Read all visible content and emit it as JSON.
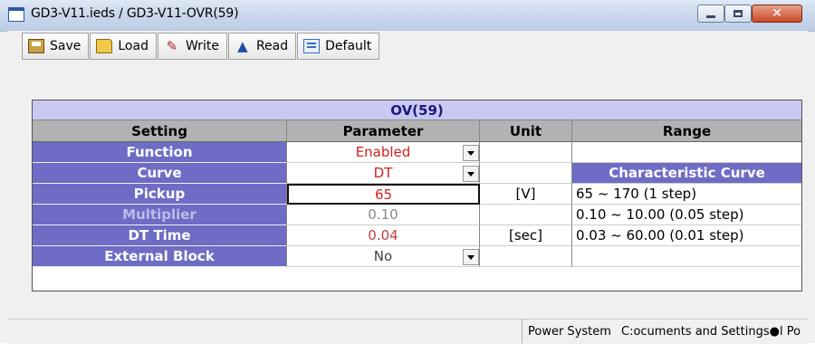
{
  "window": {
    "title": "GD3-V11.ieds / GD3-V11-OVR(59)",
    "minimize_icon": "minimize-icon",
    "maximize_icon": "maximize-icon",
    "close_icon": "close-icon"
  },
  "toolbar": {
    "buttons": [
      {
        "label": "Save",
        "icon": "save-icon"
      },
      {
        "label": "Load",
        "icon": "folder-open-icon"
      },
      {
        "label": "Write",
        "icon": "write-icon"
      },
      {
        "label": "Read",
        "icon": "arrow-up-icon"
      },
      {
        "label": "Default",
        "icon": "default-icon"
      }
    ]
  },
  "table": {
    "section_title": "OV(59)",
    "headers": {
      "setting": "Setting",
      "parameter": "Parameter",
      "unit": "Unit",
      "range": "Range"
    },
    "rows": [
      {
        "setting": "Function",
        "parameter": "Enabled",
        "unit": "",
        "range": "",
        "dropdown": true
      },
      {
        "setting": "Curve",
        "parameter": "DT",
        "unit": "",
        "range": "Characteristic Curve",
        "dropdown": true
      },
      {
        "setting": "Pickup",
        "parameter": "65",
        "unit": "[V]",
        "range": "65 ~ 170 (1 step)",
        "dropdown": false
      },
      {
        "setting": "Multiplier",
        "parameter": "0.10",
        "unit": "",
        "range": "0.10 ~ 10.00 (0.05 step)",
        "dropdown": false
      },
      {
        "setting": "DT Time",
        "parameter": "0.04",
        "unit": "[sec]",
        "range": "0.03 ~ 60.00 (0.01 step)",
        "dropdown": false
      },
      {
        "setting": "External Block",
        "parameter": "No",
        "unit": "",
        "range": "",
        "dropdown": true
      }
    ]
  },
  "statusbar": {
    "left": "",
    "middle": "Power System",
    "right": "C:ocuments and Settings●l Po"
  },
  "colors": {
    "label_bg": "#6e6cc4",
    "section_bg": "#c9c8f2",
    "header_bg": "#b2b2b2",
    "value_red": "#d42020",
    "value_gray": "#8a8a8a"
  }
}
